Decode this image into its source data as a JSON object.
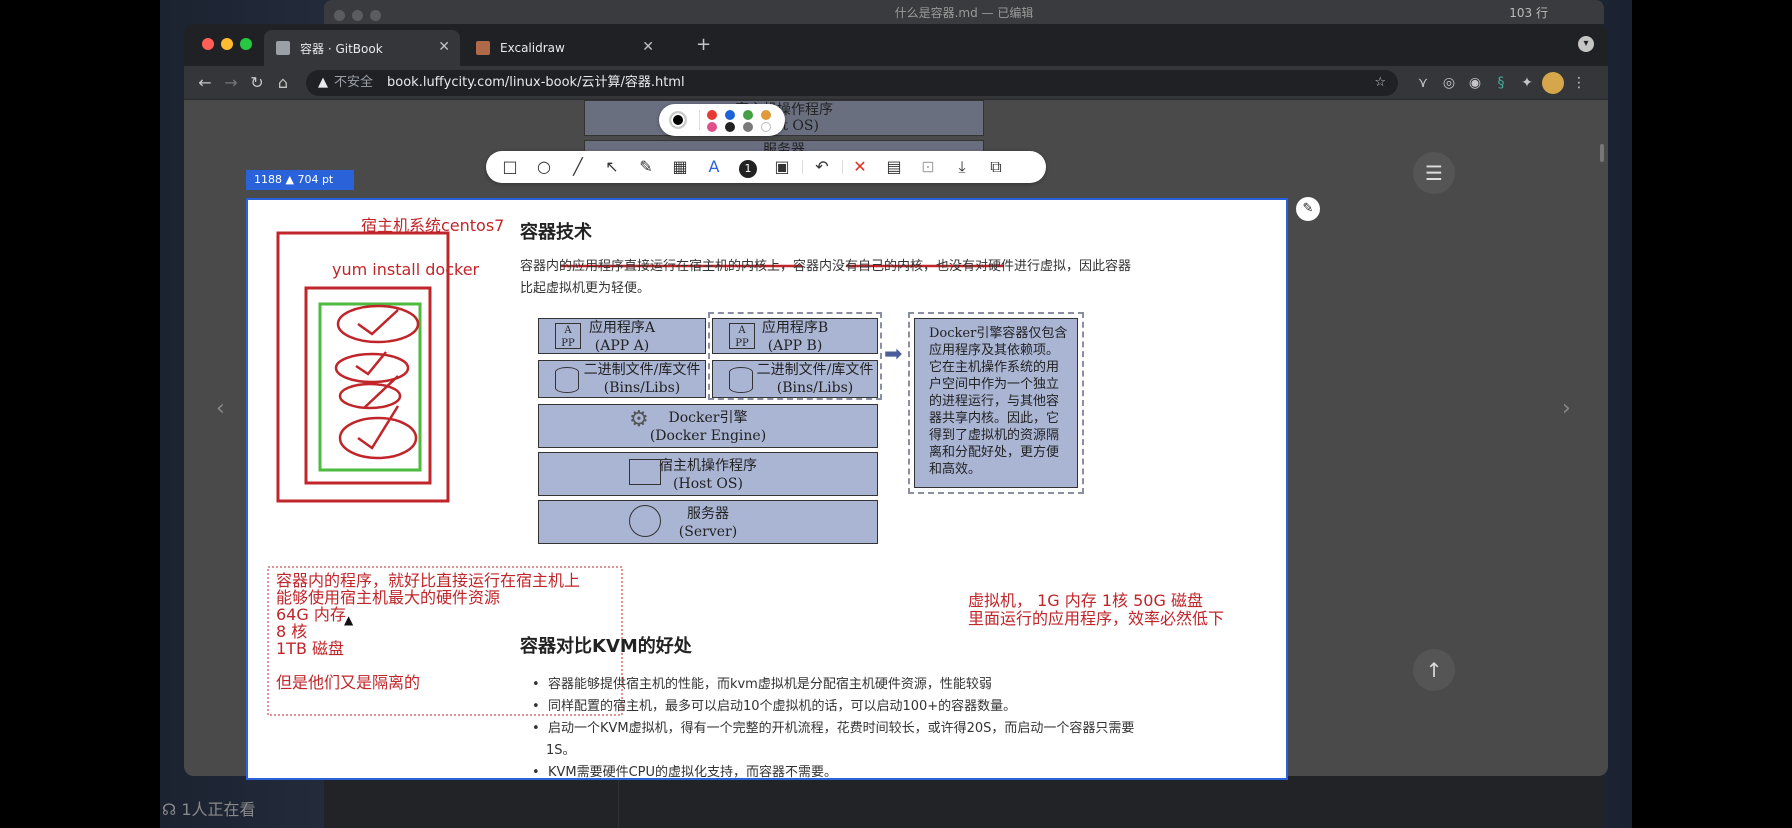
{
  "background_window": {
    "title": "什么是容器.md — 已编辑",
    "line_count": "103 行"
  },
  "browser": {
    "tabs": [
      {
        "label": "容器 · GitBook",
        "active": true
      },
      {
        "label": "Excalidraw",
        "active": false
      }
    ],
    "new_tab": "+",
    "address": {
      "security": "不安全",
      "url": "book.luffycity.com/linux-book/云计算/容器.html"
    }
  },
  "snip": {
    "size_badge": "1188 ▲ 704 pt",
    "palette_colors": [
      "#e53935",
      "#1e63d6",
      "#43a047",
      "#e09a3a",
      "#e0508a",
      "#222222",
      "#7a7a7a",
      "#ffffff"
    ],
    "tools": [
      "rectangle-icon",
      "circle-icon",
      "line-icon",
      "arrow-icon",
      "pen-icon",
      "mosaic-icon",
      "text-icon",
      "number-icon",
      "blur-icon",
      "undo-icon",
      "close-icon",
      "window-icon",
      "pin-icon",
      "download-icon",
      "copy-icon"
    ],
    "number_tool": "1"
  },
  "page": {
    "section1_title": "容器技术",
    "intro": "容器内的应用程序直接运行在宿主机的内核上，容器内没有自己的内核，也没有对硬件进行虚拟，因此容器",
    "intro2": "比起虚拟机更为轻便。",
    "diagram": {
      "app_a": "应用程序A",
      "app_a_en": "(APP A)",
      "app_b": "应用程序B",
      "app_b_en": "(APP B)",
      "bins_a": "二进制文件/库文件",
      "bins_a_en": "(Bins/Libs)",
      "bins_b": "二进制文件/库文件",
      "bins_b_en": "(Bins/Libs)",
      "engine": "Docker引擎",
      "engine_en": "(Docker Engine)",
      "hostos": "宿主机操作程序",
      "hostos_en": "(Host OS)",
      "server": "服务器",
      "server_en": "(Server)",
      "note_lines": [
        "Docker引擎容器仅包含",
        "应用程序及其依赖项。",
        "它在主机操作系统的用",
        "户空间中作为一个独立",
        "的进程运行，与其他容",
        "器共享内核。因此，它",
        "得到了虚拟机的资源隔",
        "离和分配好处，更方便",
        "和高效。"
      ]
    },
    "section2_title": "容器对比KVM的好处",
    "bullets": [
      "容器能够提供宿主机的性能，而kvm虚拟机是分配宿主机硬件资源，性能较弱",
      "同样配置的宿主机，最多可以启动10个虚拟机的话，可以启动100+的容器数量。",
      "启动一个KVM虚拟机，得有一个完整的开机流程，花费时间较长，或许得20S，而启动一个容器只需要",
      "KVM需要硬件CPU的虚拟化支持，而容器不需要。"
    ],
    "bullet3_cont": "1S。",
    "behind_diagram": {
      "hostos": "宿主机操作程序",
      "hostos_en": "(Host OS)",
      "server": "服务器"
    }
  },
  "annotations": {
    "host_label": "宿主机系统centos7",
    "docker_label": "yum install docker",
    "vm_note_1": "虚拟机，  1G 内存 1核   50G 磁盘",
    "vm_note_2": "里面运行的应用程序，效率必然低下",
    "container_note": [
      "容器内的程序，就好比直接运行在宿主机上",
      "能够使用宿主机最大的硬件资源",
      "64G 内存",
      "8 核",
      "1TB 磁盘",
      "",
      "但是他们又是隔离的"
    ]
  },
  "viewers": "1人正在看"
}
